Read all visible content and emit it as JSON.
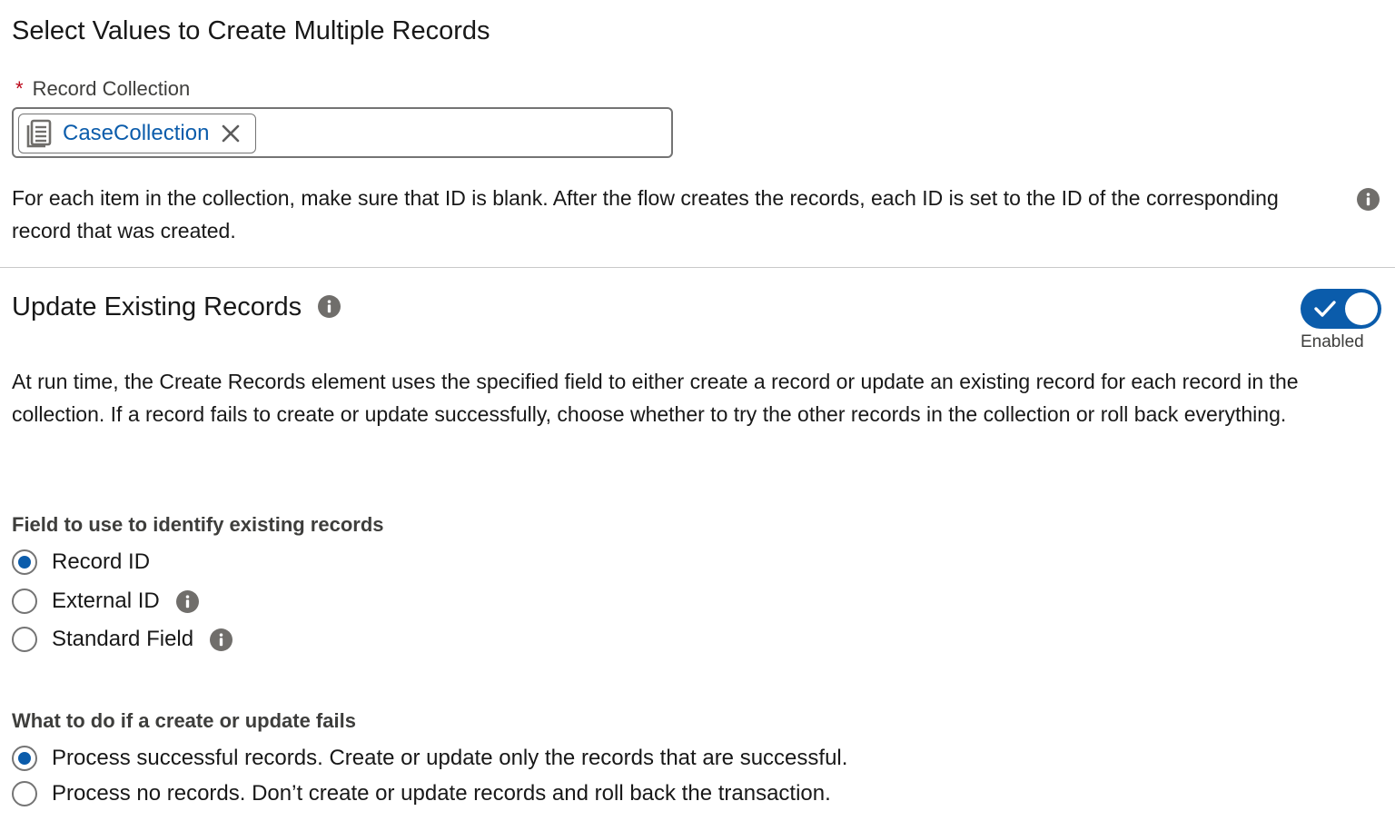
{
  "section": {
    "title": "Select Values to Create Multiple Records"
  },
  "record_collection": {
    "required_marker": "*",
    "label": "Record Collection",
    "selected_value": "CaseCollection",
    "help_text": "For each item in the collection, make sure that ID is blank. After the flow creates the records, each ID is set to the ID of the corresponding record that was created."
  },
  "update_existing": {
    "title": "Update Existing Records",
    "toggle_state": "Enabled",
    "toggle_on": true,
    "description": "At run time, the Create Records element uses the specified field to either create a record or update an existing record for each record in the collection. If a record fails to create or update successfully, choose whether to try the other records in the collection or roll back everything."
  },
  "identify_field": {
    "label": "Field to use to identify existing records",
    "options": [
      {
        "label": "Record ID",
        "checked": true,
        "info": false
      },
      {
        "label": "External ID",
        "checked": false,
        "info": true
      },
      {
        "label": "Standard Field",
        "checked": false,
        "info": true
      }
    ]
  },
  "failure_handling": {
    "label": "What to do if a create or update fails",
    "options": [
      {
        "label": "Process successful records. Create or update only the records that are successful.",
        "checked": true
      },
      {
        "label": "Process no records. Don’t create or update records and roll back the transaction.",
        "checked": false
      }
    ]
  },
  "colors": {
    "brand": "#0b5cab",
    "required": "#ba0517",
    "icon_gray": "#706e6b"
  },
  "icons": {
    "collection": "collection-variable-icon",
    "remove": "close-icon",
    "info": "info-icon",
    "check": "check-icon"
  }
}
